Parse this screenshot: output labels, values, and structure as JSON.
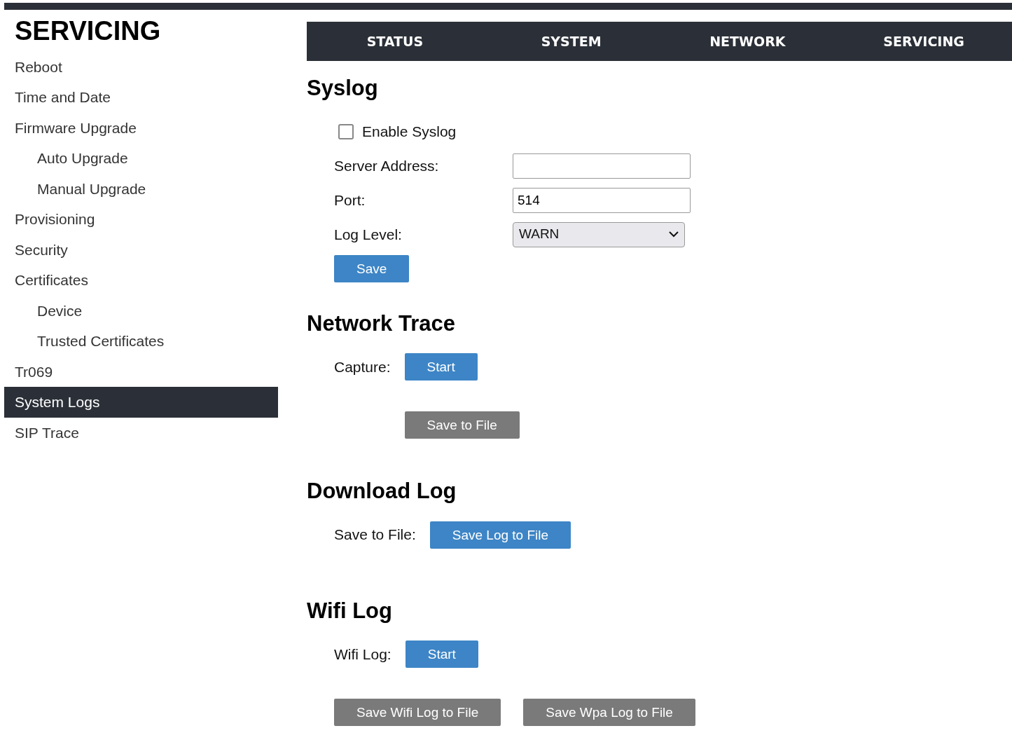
{
  "sidebar": {
    "title": "SERVICING",
    "items": [
      {
        "label": "Reboot",
        "selected": false
      },
      {
        "label": "Time and Date",
        "selected": false
      },
      {
        "label": "Firmware Upgrade",
        "selected": false,
        "children": [
          {
            "label": "Auto Upgrade",
            "selected": false
          },
          {
            "label": "Manual Upgrade",
            "selected": false
          }
        ]
      },
      {
        "label": "Provisioning",
        "selected": false
      },
      {
        "label": "Security",
        "selected": false
      },
      {
        "label": "Certificates",
        "selected": false,
        "children": [
          {
            "label": "Device",
            "selected": false
          },
          {
            "label": "Trusted Certificates",
            "selected": false
          }
        ]
      },
      {
        "label": "Tr069",
        "selected": false
      },
      {
        "label": "System Logs",
        "selected": true
      },
      {
        "label": "SIP Trace",
        "selected": false
      }
    ]
  },
  "tabs": [
    {
      "label": "STATUS"
    },
    {
      "label": "SYSTEM"
    },
    {
      "label": "NETWORK"
    },
    {
      "label": "SERVICING"
    }
  ],
  "sections": [
    {
      "title": "Syslog",
      "rows": [
        {
          "kind": "checkbox",
          "label": "Enable Syslog",
          "checked": false
        },
        {
          "kind": "text",
          "label": "Server Address:"
        },
        {
          "kind": "text",
          "label": "Port:",
          "value": "514"
        },
        {
          "kind": "select",
          "label": "Log Level:",
          "value": "WARN"
        },
        {
          "kind": "button_bar",
          "buttons": [
            {
              "label": "Save",
              "kind": "primary"
            }
          ]
        }
      ]
    },
    {
      "title": "Network Trace",
      "rows": [
        {
          "kind": "button_row",
          "label": "Capture:",
          "buttons": [
            {
              "label": "Start",
              "kind": "primary"
            }
          ]
        },
        {
          "kind": "button_row",
          "buttons": [
            {
              "label": "Save to File",
              "kind": "secondary"
            }
          ]
        }
      ]
    },
    {
      "title": "Download Log",
      "rows": [
        {
          "kind": "button_row",
          "label": "Save to File:",
          "buttons": [
            {
              "label": "Save Log to File",
              "kind": "primary"
            }
          ]
        }
      ]
    },
    {
      "title": "Wifi Log",
      "rows": [
        {
          "kind": "button_row",
          "label": "Wifi Log:",
          "buttons": [
            {
              "label": "Start",
              "kind": "primary"
            }
          ]
        },
        {
          "kind": "button_bar",
          "buttons": [
            {
              "label": "Save Wifi Log to File",
              "kind": "secondary"
            },
            {
              "label": "Save Wpa Log to File",
              "kind": "secondary"
            }
          ]
        }
      ]
    }
  ]
}
